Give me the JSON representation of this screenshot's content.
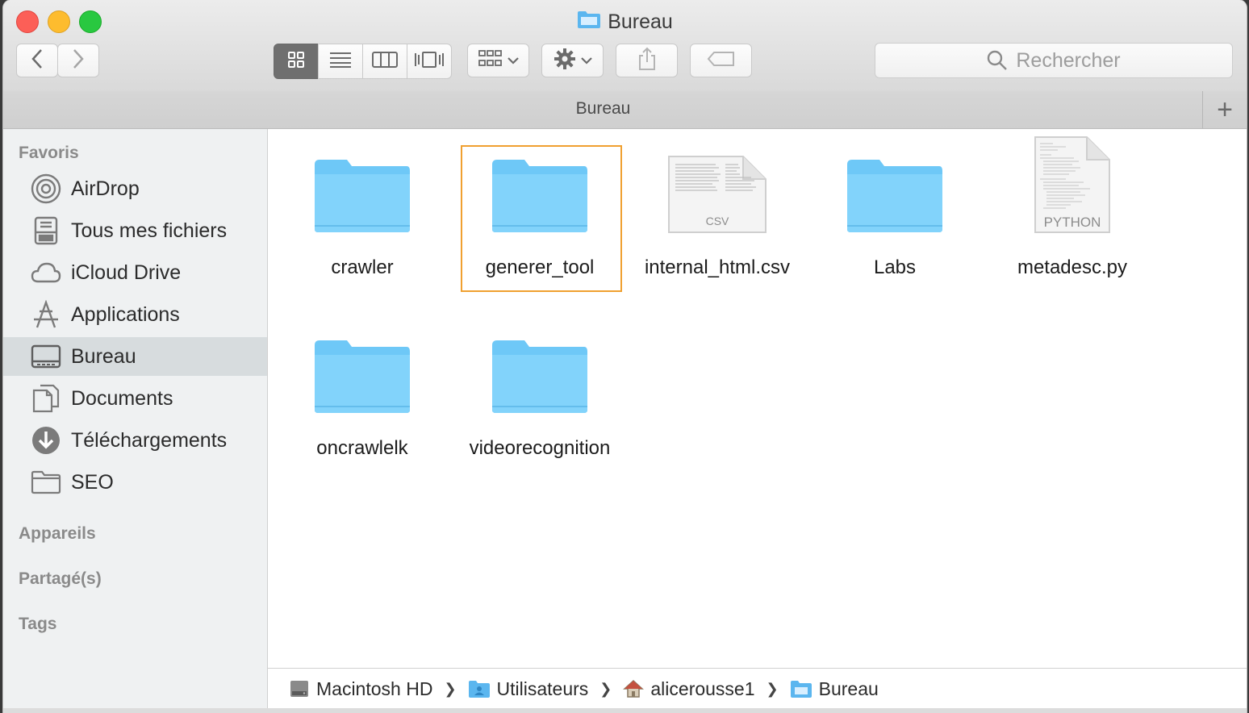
{
  "window": {
    "title": "Bureau",
    "tab_title": "Bureau",
    "tab_add_label": "+"
  },
  "toolbar": {
    "search_placeholder": "Rechercher"
  },
  "sidebar": {
    "sections": {
      "favoris": "Favoris",
      "appareils": "Appareils",
      "partages": "Partagé(s)",
      "tags": "Tags"
    },
    "items": [
      {
        "label": "AirDrop",
        "icon": "airdrop-icon"
      },
      {
        "label": "Tous mes fichiers",
        "icon": "all-files-icon"
      },
      {
        "label": "iCloud Drive",
        "icon": "cloud-icon"
      },
      {
        "label": "Applications",
        "icon": "applications-icon"
      },
      {
        "label": "Bureau",
        "icon": "desktop-icon",
        "selected": true
      },
      {
        "label": "Documents",
        "icon": "documents-icon"
      },
      {
        "label": "Téléchargements",
        "icon": "download-icon"
      },
      {
        "label": "SEO",
        "icon": "folder-icon"
      }
    ]
  },
  "files": [
    {
      "name": "crawler",
      "kind": "folder"
    },
    {
      "name": "generer_tool",
      "kind": "folder",
      "selected": true
    },
    {
      "name": "internal_html.csv",
      "kind": "csv",
      "badge": "CSV"
    },
    {
      "name": "Labs",
      "kind": "folder"
    },
    {
      "name": "metadesc.py",
      "kind": "python",
      "badge": "PYTHON"
    },
    {
      "name": "oncrawlelk",
      "kind": "folder"
    },
    {
      "name": "videorecognition",
      "kind": "folder"
    }
  ],
  "pathbar": [
    {
      "label": "Macintosh HD",
      "icon": "hard-drive-icon"
    },
    {
      "label": "Utilisateurs",
      "icon": "users-folder-icon"
    },
    {
      "label": "alicerousse1",
      "icon": "home-icon"
    },
    {
      "label": "Bureau",
      "icon": "desktop-folder-icon"
    }
  ],
  "colors": {
    "folder": "#6ec8f7",
    "selection": "#f0a030",
    "close": "#fc5f57",
    "minimize": "#fdbc2e",
    "maximize": "#29c840"
  }
}
